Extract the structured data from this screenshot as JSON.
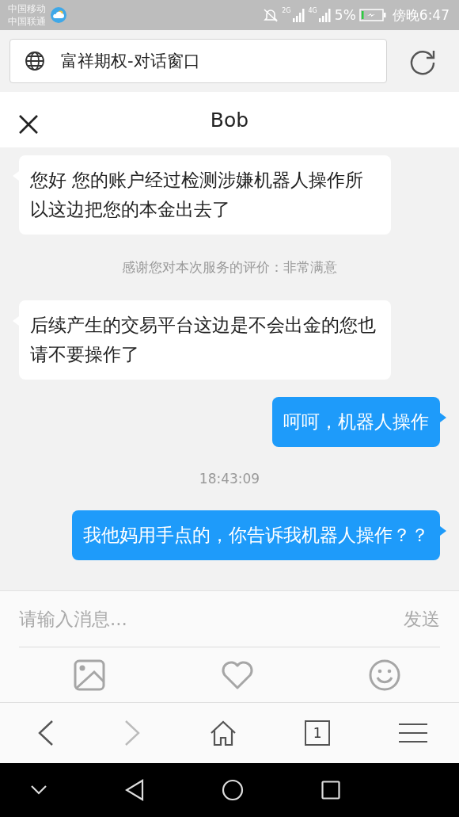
{
  "status_bar": {
    "carriers": [
      "中国移动",
      "中国联通"
    ],
    "network_1": "2G",
    "network_2": "4G",
    "battery": "5%",
    "time": "傍晚6:47"
  },
  "address_bar": {
    "title": "富祥期权-对话窗口"
  },
  "chat_header": {
    "title": "Bob"
  },
  "messages": [
    {
      "kind": "received",
      "text": "您好 您的账户经过检测涉嫌机器人操作所以这边把您的本金出去了"
    },
    {
      "kind": "notice",
      "text": "感谢您对本次服务的评价：非常满意"
    },
    {
      "kind": "received",
      "text": "后续产生的交易平台这边是不会出金的您也请不要操作了"
    },
    {
      "kind": "sent",
      "text": "呵呵，机器人操作"
    },
    {
      "kind": "time",
      "text": "18:43:09"
    },
    {
      "kind": "sent",
      "text": "我他妈用手点的，你告诉我机器人操作？？"
    }
  ],
  "composer": {
    "placeholder": "请输入消息...",
    "send": "发送"
  },
  "tab_count": "1"
}
